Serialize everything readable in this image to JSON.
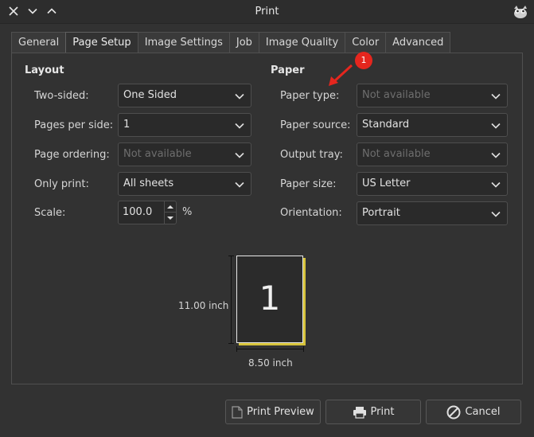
{
  "window": {
    "title": "Print"
  },
  "tabs": [
    {
      "label": "General"
    },
    {
      "label": "Page Setup"
    },
    {
      "label": "Image Settings"
    },
    {
      "label": "Job"
    },
    {
      "label": "Image Quality"
    },
    {
      "label": "Color"
    },
    {
      "label": "Advanced"
    }
  ],
  "active_tab": "Page Setup",
  "layout": {
    "title": "Layout",
    "two_sided": {
      "label": "Two-sided:",
      "value": "One Sided"
    },
    "pages_per_side": {
      "label": "Pages per side:",
      "value": "1"
    },
    "page_ordering": {
      "label": "Page ordering:",
      "value": "Not available",
      "disabled": true
    },
    "only_print": {
      "label": "Only print:",
      "value": "All sheets"
    },
    "scale": {
      "label": "Scale:",
      "value": "100.0",
      "unit": "%"
    }
  },
  "paper": {
    "title": "Paper",
    "paper_type": {
      "label": "Paper type:",
      "value": "Not available",
      "disabled": true
    },
    "paper_source": {
      "label": "Paper source:",
      "value": "Standard"
    },
    "output_tray": {
      "label": "Output tray:",
      "value": "Not available",
      "disabled": true
    },
    "paper_size": {
      "label": "Paper size:",
      "value": "US Letter"
    },
    "orientation": {
      "label": "Orientation:",
      "value": "Portrait"
    }
  },
  "annotation": {
    "number": "1",
    "color": "#e5261e"
  },
  "preview": {
    "page_number": "1",
    "height_label": "11.00 inch",
    "width_label": "8.50 inch"
  },
  "buttons": {
    "print_preview": "Print Preview",
    "print": "Print",
    "cancel": "Cancel"
  },
  "icons": {
    "close": "close-icon",
    "minimize": "chevron-down-icon",
    "maximize": "chevron-up-icon",
    "app": "gimp-logo-icon"
  }
}
